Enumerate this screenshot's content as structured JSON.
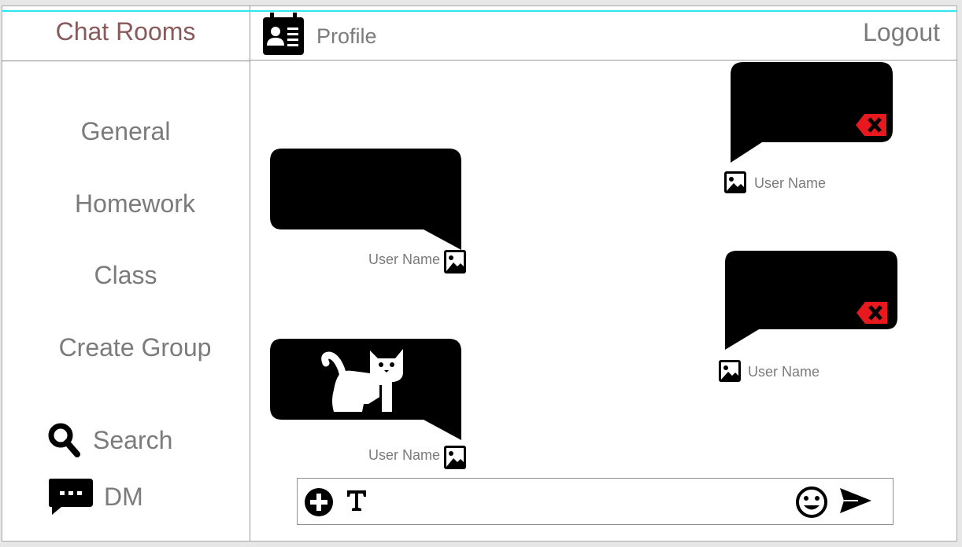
{
  "sidebar": {
    "title": "Chat Rooms",
    "rooms": [
      {
        "label": "General"
      },
      {
        "label": "Homework"
      },
      {
        "label": "Class"
      },
      {
        "label": "Create Group"
      }
    ],
    "search_label": "Search",
    "dm_label": "DM"
  },
  "topbar": {
    "profile_label": "Profile",
    "logout_label": "Logout"
  },
  "messages": [
    {
      "side": "right",
      "user": "User Name",
      "content": "",
      "deletable": true
    },
    {
      "side": "left",
      "user": "User Name",
      "content": "",
      "deletable": false
    },
    {
      "side": "right",
      "user": "User Name",
      "content": "",
      "deletable": true
    },
    {
      "side": "left",
      "user": "User Name",
      "content": "cat-image",
      "deletable": false
    }
  ],
  "composer": {
    "icons": [
      "add-circle-icon",
      "text-format-icon",
      "emoji-icon",
      "send-icon"
    ]
  },
  "colors": {
    "accent_title": "#8a5a5a",
    "delete_red": "#e8191e",
    "cyan_line": "#2ee6f2"
  }
}
